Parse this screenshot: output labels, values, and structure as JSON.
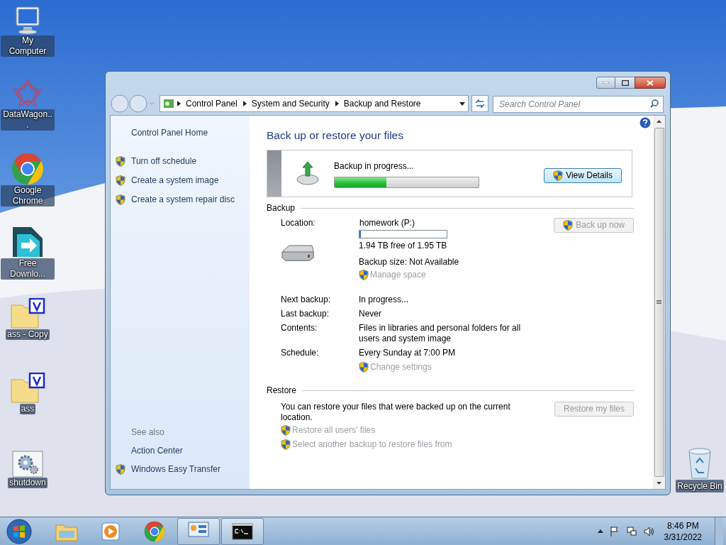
{
  "desktop_icons": [
    {
      "label": "My Computer",
      "kind": "computer"
    },
    {
      "label": "DataWagon...",
      "kind": "star"
    },
    {
      "label": "Google Chrome",
      "kind": "chrome"
    },
    {
      "label": "Free Downlo...",
      "kind": "download"
    },
    {
      "label": "ass - Copy",
      "kind": "folder"
    },
    {
      "label": "ass",
      "kind": "folder"
    },
    {
      "label": "shutdown",
      "kind": "gear"
    }
  ],
  "recycle_bin": {
    "label": "Recycle Bin"
  },
  "window": {
    "breadcrumb": [
      "Control Panel",
      "System and Security",
      "Backup and Restore"
    ],
    "search": {
      "placeholder": "Search Control Panel"
    }
  },
  "sidebar": {
    "home": "Control Panel Home",
    "tasks": [
      {
        "label": "Turn off schedule",
        "shield": true
      },
      {
        "label": "Create a system image",
        "shield": true
      },
      {
        "label": "Create a system repair disc",
        "shield": true
      }
    ],
    "see_also": {
      "heading": "See also",
      "items": [
        {
          "label": "Action Center",
          "shield": false
        },
        {
          "label": "Windows Easy Transfer",
          "shield": true
        }
      ]
    }
  },
  "content": {
    "title": "Back up or restore your files",
    "status": {
      "text": "Backup in progress...",
      "level": 0.36,
      "button": "View Details"
    },
    "backup": {
      "heading": "Backup",
      "location_label": "Location:",
      "location": "homework (P:)",
      "drive_usage": {
        "level": 0.01
      },
      "free": "1.94 TB free of 1.95 TB",
      "size": "Backup size: Not Available",
      "manage": {
        "label": "Manage space",
        "disabled": true
      },
      "button": {
        "label": "Back up now",
        "disabled": true
      },
      "details": [
        {
          "label": "Next backup:",
          "value": "In progress..."
        },
        {
          "label": "Last backup:",
          "value": "Never"
        },
        {
          "label": "Contents:",
          "value": "Files in libraries and personal folders for all users and system image"
        },
        {
          "label": "Schedule:",
          "value": "Every Sunday at 7:00 PM"
        }
      ],
      "change": {
        "label": "Change settings",
        "disabled": true
      }
    },
    "restore": {
      "heading": "Restore",
      "text": "You can restore your files that were backed up on the current location.",
      "button": {
        "label": "Restore my files",
        "disabled": true
      },
      "links": [
        {
          "label": "Restore all users' files",
          "disabled": true
        },
        {
          "label": "Select another backup to restore files from",
          "disabled": true
        }
      ]
    }
  },
  "taskbar": {
    "buttons": [
      {
        "kind": "explorer",
        "selected": false
      },
      {
        "kind": "media",
        "selected": false
      },
      {
        "kind": "chrome",
        "selected": false
      },
      {
        "kind": "control",
        "selected": true
      },
      {
        "kind": "console",
        "selected": true
      }
    ],
    "time": "8:46 PM",
    "date": "3/31/2022"
  }
}
